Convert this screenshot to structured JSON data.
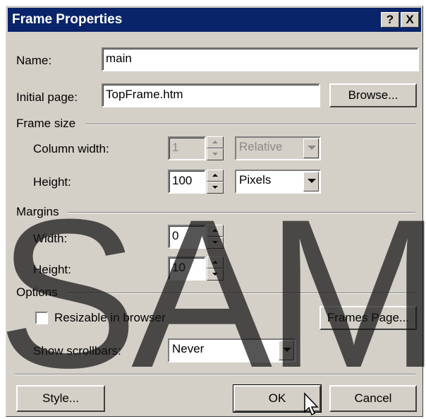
{
  "dialog": {
    "title": "Frame Properties",
    "help_button": "?",
    "close_button": "X"
  },
  "name": {
    "label": "Name:",
    "value": "main"
  },
  "initial_page": {
    "label": "Initial page:",
    "value": "TopFrame.htm",
    "browse_label": "Browse..."
  },
  "frame_size": {
    "group_label": "Frame size",
    "column_width": {
      "label": "Column width:",
      "value": "1",
      "unit": "Relative"
    },
    "height": {
      "label": "Height:",
      "value": "100",
      "unit": "Pixels"
    }
  },
  "margins": {
    "group_label": "Margins",
    "width": {
      "label": "Width:",
      "value": "0"
    },
    "height": {
      "label": "Height:",
      "value": "10"
    }
  },
  "options": {
    "group_label": "Options",
    "resizable_label": "Resizable in browser",
    "resizable_checked": false,
    "frames_page_label": "Frames Page...",
    "scrollbars_label": "Show scrollbars:",
    "scrollbars_value": "Never"
  },
  "footer": {
    "style_label": "Style...",
    "ok_label": "OK",
    "cancel_label": "Cancel"
  },
  "watermark": "SAM",
  "colors": {
    "titlebar": "#0a246a",
    "face": "#d4d0c8"
  }
}
